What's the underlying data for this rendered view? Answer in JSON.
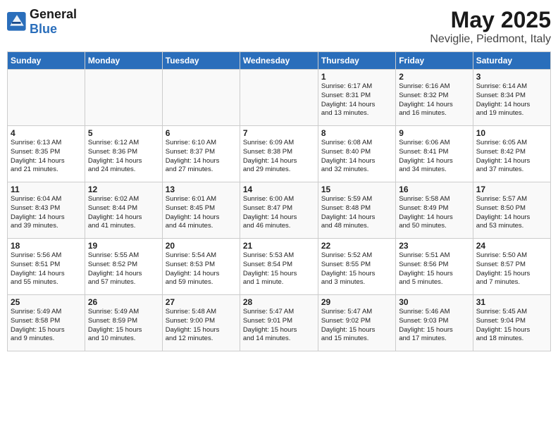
{
  "header": {
    "logo_general": "General",
    "logo_blue": "Blue",
    "month_title": "May 2025",
    "location": "Neviglie, Piedmont, Italy"
  },
  "weekdays": [
    "Sunday",
    "Monday",
    "Tuesday",
    "Wednesday",
    "Thursday",
    "Friday",
    "Saturday"
  ],
  "weeks": [
    [
      {
        "day": "",
        "info": ""
      },
      {
        "day": "",
        "info": ""
      },
      {
        "day": "",
        "info": ""
      },
      {
        "day": "",
        "info": ""
      },
      {
        "day": "1",
        "info": "Sunrise: 6:17 AM\nSunset: 8:31 PM\nDaylight: 14 hours\nand 13 minutes."
      },
      {
        "day": "2",
        "info": "Sunrise: 6:16 AM\nSunset: 8:32 PM\nDaylight: 14 hours\nand 16 minutes."
      },
      {
        "day": "3",
        "info": "Sunrise: 6:14 AM\nSunset: 8:34 PM\nDaylight: 14 hours\nand 19 minutes."
      }
    ],
    [
      {
        "day": "4",
        "info": "Sunrise: 6:13 AM\nSunset: 8:35 PM\nDaylight: 14 hours\nand 21 minutes."
      },
      {
        "day": "5",
        "info": "Sunrise: 6:12 AM\nSunset: 8:36 PM\nDaylight: 14 hours\nand 24 minutes."
      },
      {
        "day": "6",
        "info": "Sunrise: 6:10 AM\nSunset: 8:37 PM\nDaylight: 14 hours\nand 27 minutes."
      },
      {
        "day": "7",
        "info": "Sunrise: 6:09 AM\nSunset: 8:38 PM\nDaylight: 14 hours\nand 29 minutes."
      },
      {
        "day": "8",
        "info": "Sunrise: 6:08 AM\nSunset: 8:40 PM\nDaylight: 14 hours\nand 32 minutes."
      },
      {
        "day": "9",
        "info": "Sunrise: 6:06 AM\nSunset: 8:41 PM\nDaylight: 14 hours\nand 34 minutes."
      },
      {
        "day": "10",
        "info": "Sunrise: 6:05 AM\nSunset: 8:42 PM\nDaylight: 14 hours\nand 37 minutes."
      }
    ],
    [
      {
        "day": "11",
        "info": "Sunrise: 6:04 AM\nSunset: 8:43 PM\nDaylight: 14 hours\nand 39 minutes."
      },
      {
        "day": "12",
        "info": "Sunrise: 6:02 AM\nSunset: 8:44 PM\nDaylight: 14 hours\nand 41 minutes."
      },
      {
        "day": "13",
        "info": "Sunrise: 6:01 AM\nSunset: 8:45 PM\nDaylight: 14 hours\nand 44 minutes."
      },
      {
        "day": "14",
        "info": "Sunrise: 6:00 AM\nSunset: 8:47 PM\nDaylight: 14 hours\nand 46 minutes."
      },
      {
        "day": "15",
        "info": "Sunrise: 5:59 AM\nSunset: 8:48 PM\nDaylight: 14 hours\nand 48 minutes."
      },
      {
        "day": "16",
        "info": "Sunrise: 5:58 AM\nSunset: 8:49 PM\nDaylight: 14 hours\nand 50 minutes."
      },
      {
        "day": "17",
        "info": "Sunrise: 5:57 AM\nSunset: 8:50 PM\nDaylight: 14 hours\nand 53 minutes."
      }
    ],
    [
      {
        "day": "18",
        "info": "Sunrise: 5:56 AM\nSunset: 8:51 PM\nDaylight: 14 hours\nand 55 minutes."
      },
      {
        "day": "19",
        "info": "Sunrise: 5:55 AM\nSunset: 8:52 PM\nDaylight: 14 hours\nand 57 minutes."
      },
      {
        "day": "20",
        "info": "Sunrise: 5:54 AM\nSunset: 8:53 PM\nDaylight: 14 hours\nand 59 minutes."
      },
      {
        "day": "21",
        "info": "Sunrise: 5:53 AM\nSunset: 8:54 PM\nDaylight: 15 hours\nand 1 minute."
      },
      {
        "day": "22",
        "info": "Sunrise: 5:52 AM\nSunset: 8:55 PM\nDaylight: 15 hours\nand 3 minutes."
      },
      {
        "day": "23",
        "info": "Sunrise: 5:51 AM\nSunset: 8:56 PM\nDaylight: 15 hours\nand 5 minutes."
      },
      {
        "day": "24",
        "info": "Sunrise: 5:50 AM\nSunset: 8:57 PM\nDaylight: 15 hours\nand 7 minutes."
      }
    ],
    [
      {
        "day": "25",
        "info": "Sunrise: 5:49 AM\nSunset: 8:58 PM\nDaylight: 15 hours\nand 9 minutes."
      },
      {
        "day": "26",
        "info": "Sunrise: 5:49 AM\nSunset: 8:59 PM\nDaylight: 15 hours\nand 10 minutes."
      },
      {
        "day": "27",
        "info": "Sunrise: 5:48 AM\nSunset: 9:00 PM\nDaylight: 15 hours\nand 12 minutes."
      },
      {
        "day": "28",
        "info": "Sunrise: 5:47 AM\nSunset: 9:01 PM\nDaylight: 15 hours\nand 14 minutes."
      },
      {
        "day": "29",
        "info": "Sunrise: 5:47 AM\nSunset: 9:02 PM\nDaylight: 15 hours\nand 15 minutes."
      },
      {
        "day": "30",
        "info": "Sunrise: 5:46 AM\nSunset: 9:03 PM\nDaylight: 15 hours\nand 17 minutes."
      },
      {
        "day": "31",
        "info": "Sunrise: 5:45 AM\nSunset: 9:04 PM\nDaylight: 15 hours\nand 18 minutes."
      }
    ]
  ]
}
